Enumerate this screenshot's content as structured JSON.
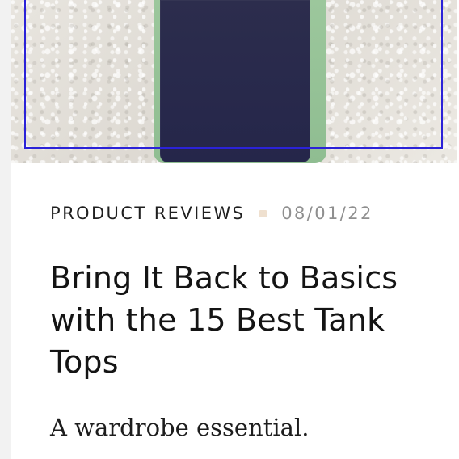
{
  "article": {
    "category": "PRODUCT REVIEWS",
    "date": "08/01/22",
    "title": "Bring It Back to Basics with the 15 Best Tank Tops",
    "summary": "A wardrobe essential."
  },
  "colors": {
    "page_background": "#f2f2f2",
    "card_background": "#ffffff",
    "focus_outline": "#2b22d8",
    "meta_dot": "#efe0cf",
    "tank_primary": "#25264a",
    "tank_trim": "#9cc79c"
  }
}
